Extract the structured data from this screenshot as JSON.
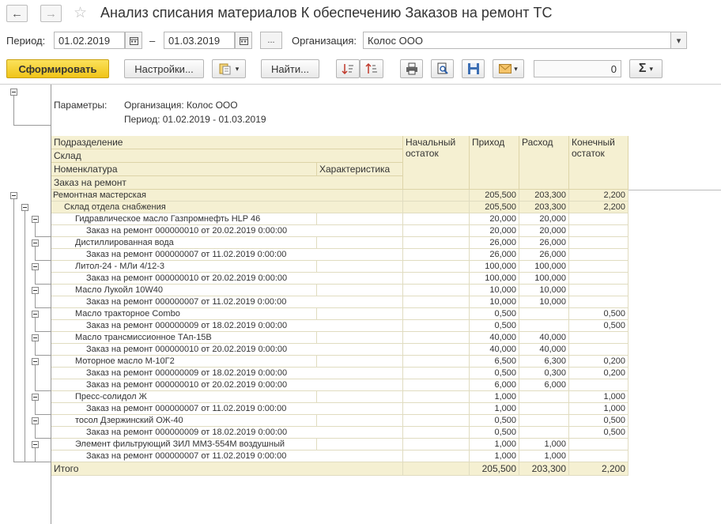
{
  "window": {
    "title": "Анализ списания материалов К обеспечению Заказов на ремонт ТС"
  },
  "filters": {
    "period_label": "Период:",
    "date_from": "01.02.2019",
    "dash": "–",
    "date_to": "01.03.2019",
    "more": "...",
    "org_label": "Организация:",
    "org_value": "Колос ООО"
  },
  "toolbar": {
    "generate": "Сформировать",
    "settings": "Настройки...",
    "find": "Найти...",
    "sum_value": "0",
    "sigma": "Σ"
  },
  "report": {
    "params_label": "Параметры:",
    "param_org": "Организация: Колос ООО",
    "param_period": "Период: 01.02.2019 - 01.03.2019",
    "headers": {
      "subdivision": "Подразделение",
      "warehouse": "Склад",
      "nomenclature": "Номенклатура",
      "characteristic": "Характеристика",
      "order": "Заказ на ремонт",
      "opening": "Начальный\nостаток",
      "income": "Приход",
      "expense": "Расход",
      "closing": "Конечный\nостаток"
    },
    "rows": [
      {
        "level": 0,
        "name": "Ремонтная мастерская",
        "open": "",
        "inc": "205,500",
        "exp": "203,300",
        "close": "2,200"
      },
      {
        "level": 1,
        "name": "Склад отдела снабжения",
        "open": "",
        "inc": "205,500",
        "exp": "203,300",
        "close": "2,200"
      },
      {
        "level": 2,
        "name": "Гидравлическое масло Газпромнефть HLP 46",
        "open": "",
        "inc": "20,000",
        "exp": "20,000",
        "close": ""
      },
      {
        "level": 3,
        "name": "Заказ на ремонт 000000010 от 20.02.2019 0:00:00",
        "open": "",
        "inc": "20,000",
        "exp": "20,000",
        "close": ""
      },
      {
        "level": 2,
        "name": "Дистиллированная вода",
        "open": "",
        "inc": "26,000",
        "exp": "26,000",
        "close": ""
      },
      {
        "level": 3,
        "name": "Заказ на ремонт 000000007 от 11.02.2019 0:00:00",
        "open": "",
        "inc": "26,000",
        "exp": "26,000",
        "close": ""
      },
      {
        "level": 2,
        "name": "Литол-24 - МЛи 4/12-3",
        "open": "",
        "inc": "100,000",
        "exp": "100,000",
        "close": ""
      },
      {
        "level": 3,
        "name": "Заказ на ремонт 000000010 от 20.02.2019 0:00:00",
        "open": "",
        "inc": "100,000",
        "exp": "100,000",
        "close": ""
      },
      {
        "level": 2,
        "name": "Масло Лукойл 10W40",
        "open": "",
        "inc": "10,000",
        "exp": "10,000",
        "close": ""
      },
      {
        "level": 3,
        "name": "Заказ на ремонт 000000007 от 11.02.2019 0:00:00",
        "open": "",
        "inc": "10,000",
        "exp": "10,000",
        "close": ""
      },
      {
        "level": 2,
        "name": "Масло тракторное Combo",
        "open": "",
        "inc": "0,500",
        "exp": "",
        "close": "0,500"
      },
      {
        "level": 3,
        "name": "Заказ на ремонт 000000009 от 18.02.2019 0:00:00",
        "open": "",
        "inc": "0,500",
        "exp": "",
        "close": "0,500"
      },
      {
        "level": 2,
        "name": "Масло трансмиссионное ТАп-15В",
        "open": "",
        "inc": "40,000",
        "exp": "40,000",
        "close": ""
      },
      {
        "level": 3,
        "name": "Заказ на ремонт 000000010 от 20.02.2019 0:00:00",
        "open": "",
        "inc": "40,000",
        "exp": "40,000",
        "close": ""
      },
      {
        "level": 2,
        "name": "Моторное масло М-10Г2",
        "open": "",
        "inc": "6,500",
        "exp": "6,300",
        "close": "0,200"
      },
      {
        "level": 3,
        "name": "Заказ на ремонт 000000009 от 18.02.2019 0:00:00",
        "open": "",
        "inc": "0,500",
        "exp": "0,300",
        "close": "0,200"
      },
      {
        "level": 3,
        "name": "Заказ на ремонт 000000010 от 20.02.2019 0:00:00",
        "open": "",
        "inc": "6,000",
        "exp": "6,000",
        "close": ""
      },
      {
        "level": 2,
        "name": "Пресс-солидол Ж",
        "open": "",
        "inc": "1,000",
        "exp": "",
        "close": "1,000"
      },
      {
        "level": 3,
        "name": "Заказ на ремонт 000000007 от 11.02.2019 0:00:00",
        "open": "",
        "inc": "1,000",
        "exp": "",
        "close": "1,000"
      },
      {
        "level": 2,
        "name": "тосол Дзержинский ОЖ-40",
        "open": "",
        "inc": "0,500",
        "exp": "",
        "close": "0,500"
      },
      {
        "level": 3,
        "name": "Заказ на ремонт 000000009 от 18.02.2019 0:00:00",
        "open": "",
        "inc": "0,500",
        "exp": "",
        "close": "0,500"
      },
      {
        "level": 2,
        "name": "Элемент фильтрующий ЗИЛ ММЗ-554М воздушный",
        "open": "",
        "inc": "1,000",
        "exp": "1,000",
        "close": ""
      },
      {
        "level": 3,
        "name": "Заказ на ремонт 000000007 от 11.02.2019 0:00:00",
        "open": "",
        "inc": "1,000",
        "exp": "1,000",
        "close": ""
      }
    ],
    "total": {
      "label": "Итого",
      "open": "",
      "inc": "205,500",
      "exp": "203,300",
      "close": "2,200"
    }
  },
  "colors": {
    "header_bg": "#f5f0d2",
    "primary_button": "#f0c419"
  }
}
